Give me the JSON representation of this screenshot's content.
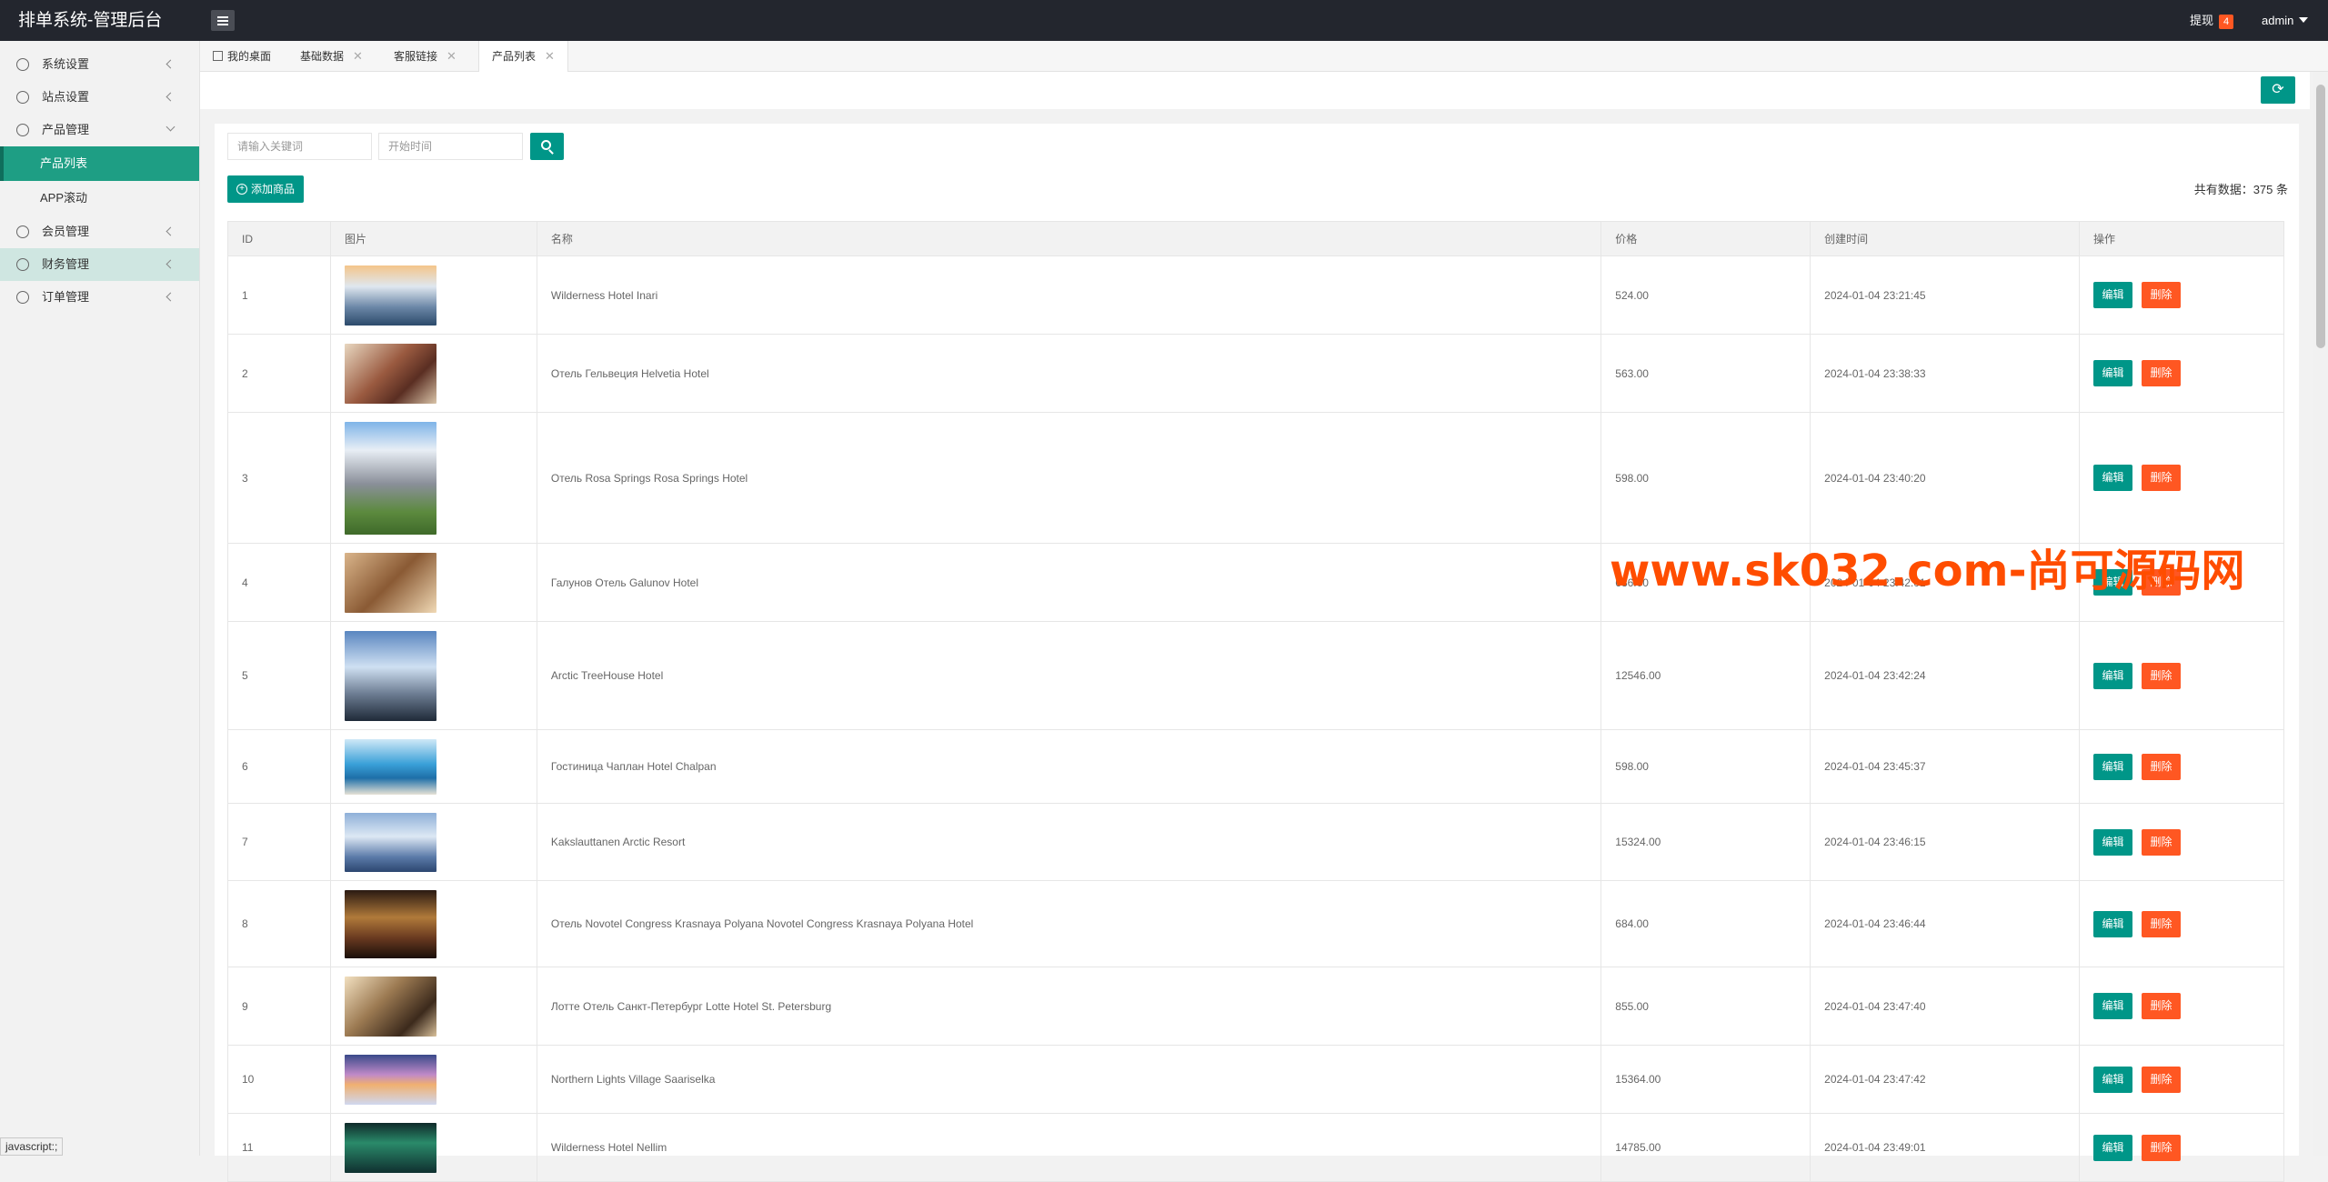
{
  "header": {
    "brand": "排单系统-管理后台",
    "withdraw_label": "提现",
    "withdraw_count": "4",
    "user": "admin"
  },
  "sidebar": {
    "items": [
      {
        "label": "系统设置",
        "icon": "gear-icon"
      },
      {
        "label": "站点设置",
        "icon": "globe-icon"
      },
      {
        "label": "产品管理",
        "icon": "box-icon",
        "sub": [
          {
            "label": "产品列表",
            "active": true
          },
          {
            "label": "APP滚动"
          }
        ]
      },
      {
        "label": "会员管理",
        "icon": "user-icon"
      },
      {
        "label": "财务管理",
        "icon": "money-icon"
      },
      {
        "label": "订单管理",
        "icon": "order-icon"
      }
    ]
  },
  "tabs": [
    {
      "label": "我的桌面"
    },
    {
      "label": "基础数据"
    },
    {
      "label": "客服链接"
    },
    {
      "label": "产品列表"
    }
  ],
  "search": {
    "keyword_placeholder": "请输入关键词",
    "date_placeholder": "开始时间"
  },
  "add_button": "添加商品",
  "total": "共有数据：375 条",
  "table": {
    "columns": [
      "ID",
      "图片",
      "名称",
      "价格",
      "创建时间",
      "操作"
    ],
    "edit_label": "编辑",
    "delete_label": "删除",
    "rows": [
      {
        "id": "1",
        "name": "Wilderness Hotel Inari",
        "price": "524.00",
        "created": "2024-01-04 23:21:45"
      },
      {
        "id": "2",
        "name": "Отель Гельвеция Helvetia Hotel",
        "price": "563.00",
        "created": "2024-01-04 23:38:33"
      },
      {
        "id": "3",
        "name": "Отель Rosa Springs Rosa Springs Hotel",
        "price": "598.00",
        "created": "2024-01-04 23:40:20"
      },
      {
        "id": "4",
        "name": "Галунов Отель Galunov Hotel",
        "price": "636.00",
        "created": "2024-01-04 23:42:01"
      },
      {
        "id": "5",
        "name": "Arctic TreeHouse Hotel",
        "price": "12546.00",
        "created": "2024-01-04 23:42:24"
      },
      {
        "id": "6",
        "name": "Гостиница Чаплан Hotel Chalpan",
        "price": "598.00",
        "created": "2024-01-04 23:45:37"
      },
      {
        "id": "7",
        "name": "Kakslauttanen Arctic Resort",
        "price": "15324.00",
        "created": "2024-01-04 23:46:15"
      },
      {
        "id": "8",
        "name": "Отель Novotel Congress Krasnaya Polyana Novotel Congress Krasnaya Polyana Hotel",
        "price": "684.00",
        "created": "2024-01-04 23:46:44"
      },
      {
        "id": "9",
        "name": "Лотте Отель Санкт-Петербург Lotte Hotel St. Petersburg",
        "price": "855.00",
        "created": "2024-01-04 23:47:40"
      },
      {
        "id": "10",
        "name": "Northern Lights Village Saariselka",
        "price": "15364.00",
        "created": "2024-01-04 23:47:42"
      },
      {
        "id": "11",
        "name": "Wilderness Hotel Nellim",
        "price": "14785.00",
        "created": "2024-01-04 23:49:01"
      }
    ]
  },
  "watermark": "www.sk032.com-尚可源码网",
  "statusbar": "javascript:;"
}
